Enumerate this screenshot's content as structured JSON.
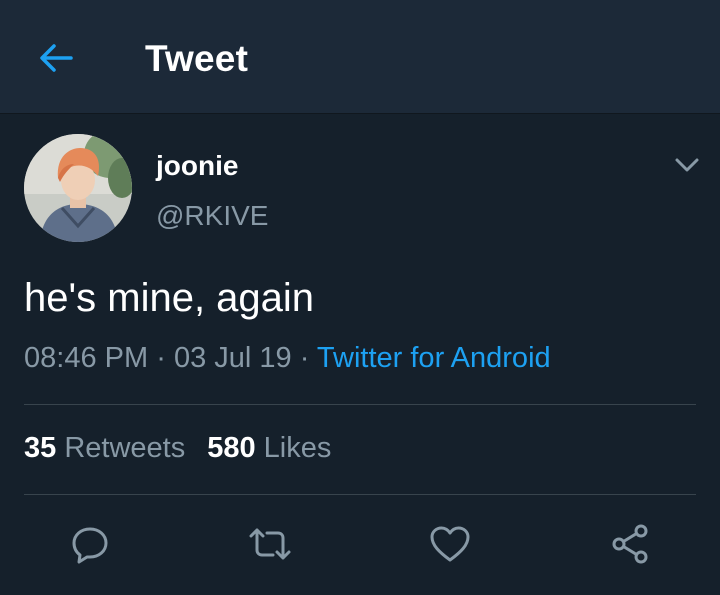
{
  "header": {
    "back_icon": "arrow-left-icon",
    "title": "Tweet"
  },
  "tweet": {
    "display_name": "joonie",
    "handle": "@RKIVE",
    "text": "he's mine, again",
    "time": "08:46 PM",
    "separator": "·",
    "date": "03 Jul 19",
    "source": "Twitter for Android",
    "caret_icon": "chevron-down-icon"
  },
  "stats": {
    "retweets_count": "35",
    "retweets_label": "Retweets",
    "likes_count": "580",
    "likes_label": "Likes"
  },
  "actions": [
    {
      "icon": "reply-icon"
    },
    {
      "icon": "retweet-icon"
    },
    {
      "icon": "like-heart-icon"
    },
    {
      "icon": "share-icon"
    }
  ],
  "colors": {
    "background": "#15202b",
    "header_background": "#1c2938",
    "accent": "#1da1f2",
    "secondary_text": "#8899a6",
    "divider": "#38444d"
  }
}
